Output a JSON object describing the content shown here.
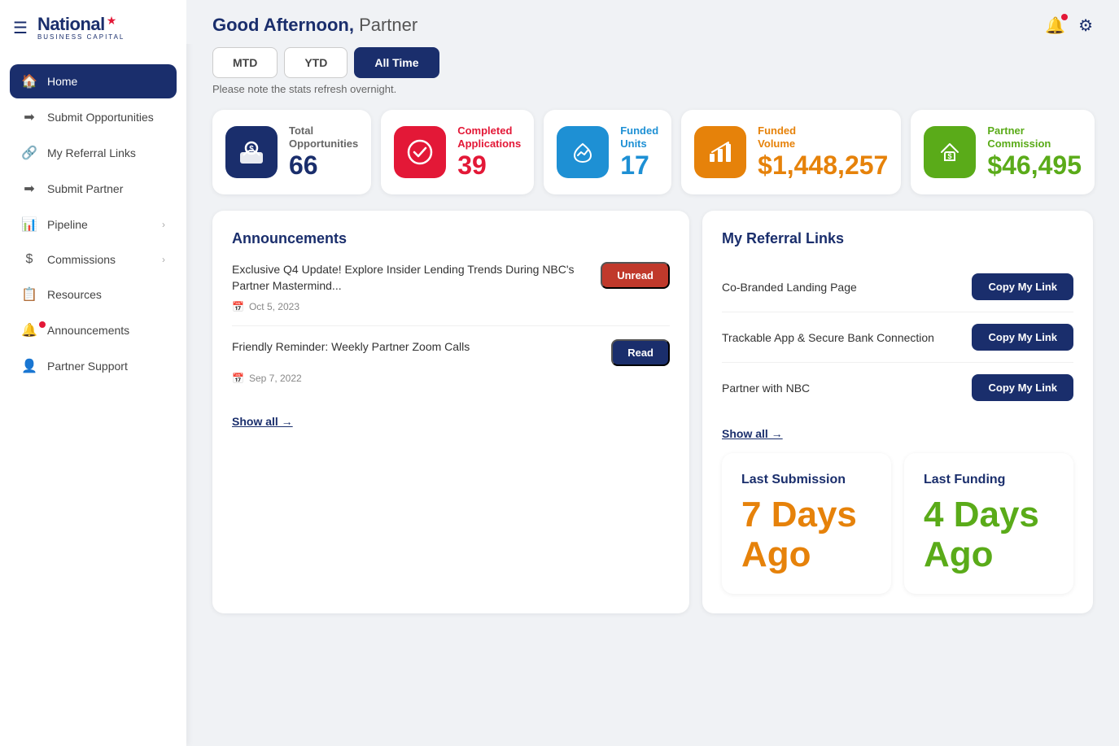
{
  "sidebar": {
    "logo": {
      "brand": "National",
      "sub": "Business Capital",
      "star": "★"
    },
    "items": [
      {
        "id": "home",
        "label": "Home",
        "icon": "🏠",
        "active": true,
        "has_arrow": false,
        "has_notif": false
      },
      {
        "id": "submit-opportunities",
        "label": "Submit Opportunities",
        "icon": "➡",
        "active": false,
        "has_arrow": false,
        "has_notif": false
      },
      {
        "id": "my-referral-links",
        "label": "My Referral Links",
        "icon": "🔗",
        "active": false,
        "has_arrow": false,
        "has_notif": false
      },
      {
        "id": "submit-partner",
        "label": "Submit Partner",
        "icon": "➡",
        "active": false,
        "has_arrow": false,
        "has_notif": false
      },
      {
        "id": "pipeline",
        "label": "Pipeline",
        "icon": "📊",
        "active": false,
        "has_arrow": true,
        "has_notif": false
      },
      {
        "id": "commissions",
        "label": "Commissions",
        "icon": "$",
        "active": false,
        "has_arrow": true,
        "has_notif": false
      },
      {
        "id": "resources",
        "label": "Resources",
        "icon": "📋",
        "active": false,
        "has_arrow": false,
        "has_notif": false
      },
      {
        "id": "announcements",
        "label": "Announcements",
        "icon": "🔔",
        "active": false,
        "has_arrow": false,
        "has_notif": true
      },
      {
        "id": "partner-support",
        "label": "Partner Support",
        "icon": "👤",
        "active": false,
        "has_arrow": false,
        "has_notif": false
      }
    ]
  },
  "header": {
    "greeting_prefix": "Good Afternoon,",
    "greeting_name": "Partner"
  },
  "tabs": [
    {
      "id": "mtd",
      "label": "MTD",
      "active": false
    },
    {
      "id": "ytd",
      "label": "YTD",
      "active": false
    },
    {
      "id": "all-time",
      "label": "All Time",
      "active": true
    }
  ],
  "tab_note": "Please note the stats refresh overnight.",
  "stats": [
    {
      "id": "total-opportunities",
      "color": "dark-blue",
      "label": "Total\nOpportunities",
      "label_color": "default",
      "value": "66",
      "value_color": "default",
      "icon": "💰"
    },
    {
      "id": "completed-applications",
      "color": "red",
      "label": "Completed\nApplications",
      "label_color": "red",
      "value": "39",
      "value_color": "red",
      "icon": "✔"
    },
    {
      "id": "funded-units",
      "color": "blue",
      "label": "Funded\nUnits",
      "label_color": "blue",
      "value": "17",
      "value_color": "blue",
      "icon": "🤝"
    },
    {
      "id": "funded-volume",
      "color": "orange",
      "label": "Funded\nVolume",
      "label_color": "orange",
      "value": "$1,448,257",
      "value_color": "orange",
      "icon": "📈"
    },
    {
      "id": "partner-commission",
      "color": "green",
      "label": "Partner\nCommission",
      "label_color": "green",
      "value": "$46,495",
      "value_color": "green",
      "icon": "💼"
    }
  ],
  "announcements": {
    "title": "Announcements",
    "items": [
      {
        "text": "Exclusive Q4 Update! Explore Insider Lending Trends During NBC's Partner Mastermind...",
        "badge": "Unread",
        "badge_type": "unread",
        "date": "Oct 5, 2023"
      },
      {
        "text": "Friendly Reminder: Weekly Partner Zoom Calls",
        "badge": "Read",
        "badge_type": "read",
        "date": "Sep 7, 2022"
      }
    ],
    "show_all": "Show all →"
  },
  "referral_links": {
    "title": "My Referral Links",
    "items": [
      {
        "label": "Co-Branded Landing Page",
        "btn": "Copy My Link"
      },
      {
        "label": "Trackable App & Secure Bank Connection",
        "btn": "Copy My Link"
      },
      {
        "label": "Partner with NBC",
        "btn": "Copy My Link"
      }
    ],
    "show_all": "Show all →"
  },
  "bottom_stats": [
    {
      "title": "Last Submission",
      "value_line1": "7 Days",
      "value_line2": "Ago",
      "color": "orange"
    },
    {
      "title": "Last Funding",
      "value_line1": "4 Days",
      "value_line2": "Ago",
      "color": "green"
    }
  ]
}
